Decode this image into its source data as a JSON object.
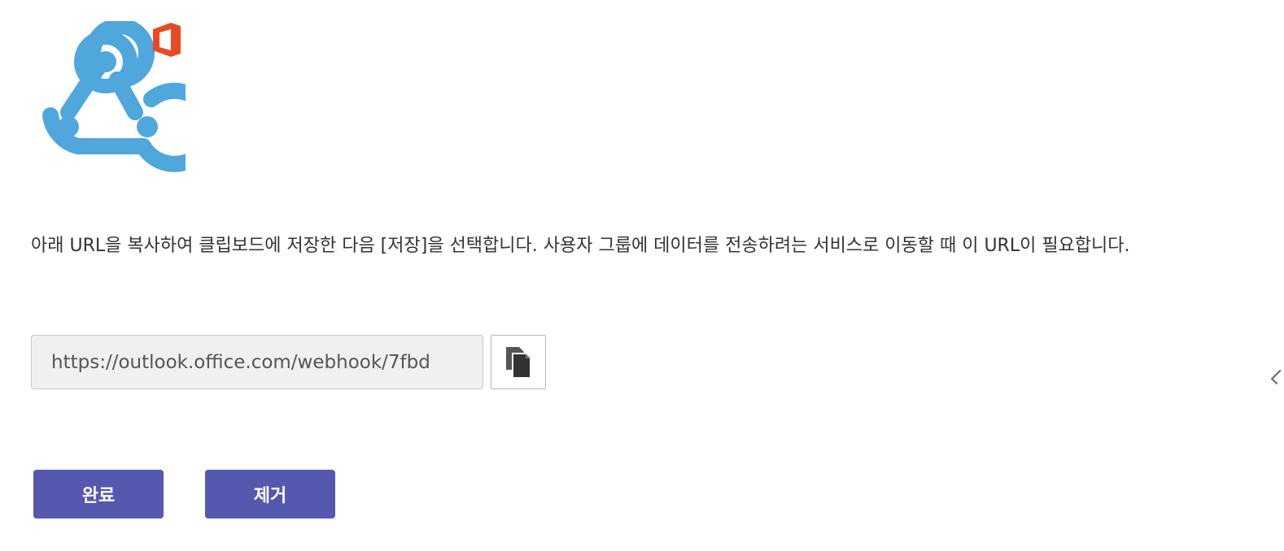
{
  "logo": {
    "icon": "webhook-office-logo-icon",
    "colors": {
      "webhook": "#4fa7dc",
      "office": "#e64b24"
    }
  },
  "description": "아래 URL을 복사하여 클립보드에 저장한 다음 [저장]을 선택합니다. 사용자 그룹에 데이터를 전송하려는 서비스로 이동할 때 이 URL이 필요합니다.",
  "url_field": {
    "value": "https://outlook.office.com/webhook/7fbd"
  },
  "copy_button": {
    "icon": "copy-icon"
  },
  "buttons": {
    "done_label": "완료",
    "remove_label": "제거",
    "color": "#5558af"
  }
}
